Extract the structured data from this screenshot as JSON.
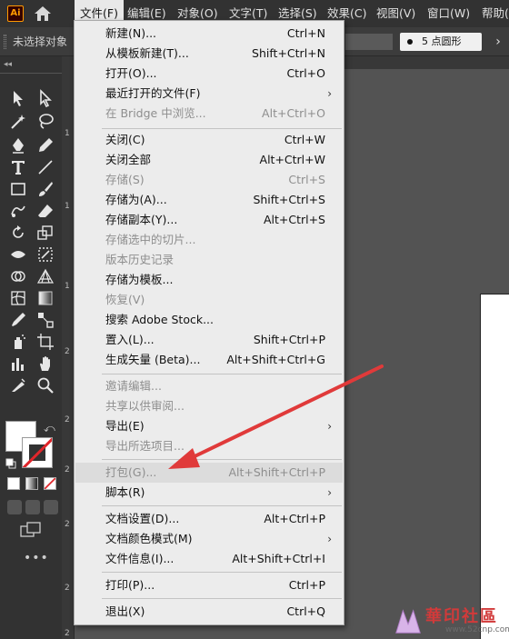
{
  "app": {
    "logo_text": "Ai"
  },
  "menubar": {
    "items": [
      {
        "label": "文件(F)",
        "active": true
      },
      {
        "label": "编辑(E)"
      },
      {
        "label": "对象(O)"
      },
      {
        "label": "文字(T)"
      },
      {
        "label": "选择(S)"
      },
      {
        "label": "效果(C)"
      },
      {
        "label": "视图(V)"
      },
      {
        "label": "窗口(W)"
      },
      {
        "label": "帮助("
      }
    ]
  },
  "controlbar": {
    "selection_status": "未选择对象",
    "brush": {
      "size": "5",
      "label": "点圆形"
    }
  },
  "ruler": {
    "numbers": [
      "1",
      "1",
      "1",
      "2",
      "2",
      "2",
      "2",
      "2",
      "2"
    ]
  },
  "file_menu": {
    "items": [
      {
        "label": "新建(N)...",
        "shortcut": "Ctrl+N",
        "enabled": true
      },
      {
        "label": "从模板新建(T)...",
        "shortcut": "Shift+Ctrl+N",
        "enabled": true
      },
      {
        "label": "打开(O)...",
        "shortcut": "Ctrl+O",
        "enabled": true
      },
      {
        "label": "最近打开的文件(F)",
        "shortcut": "",
        "submenu": true,
        "enabled": true
      },
      {
        "label": "在 Bridge 中浏览...",
        "shortcut": "Alt+Ctrl+O",
        "enabled": false
      },
      {
        "label": "关闭(C)",
        "shortcut": "Ctrl+W",
        "enabled": true
      },
      {
        "label": "关闭全部",
        "shortcut": "Alt+Ctrl+W",
        "enabled": true
      },
      {
        "label": "存储(S)",
        "shortcut": "Ctrl+S",
        "enabled": false
      },
      {
        "label": "存储为(A)...",
        "shortcut": "Shift+Ctrl+S",
        "enabled": true
      },
      {
        "label": "存储副本(Y)...",
        "shortcut": "Alt+Ctrl+S",
        "enabled": true
      },
      {
        "label": "存储选中的切片...",
        "shortcut": "",
        "enabled": false
      },
      {
        "label": "版本历史记录",
        "shortcut": "",
        "enabled": false
      },
      {
        "label": "存储为模板...",
        "shortcut": "",
        "enabled": true
      },
      {
        "label": "恢复(V)",
        "shortcut": "",
        "enabled": false
      },
      {
        "label": "搜索 Adobe Stock...",
        "shortcut": "",
        "enabled": true
      },
      {
        "label": "置入(L)...",
        "shortcut": "Shift+Ctrl+P",
        "enabled": true
      },
      {
        "label": "生成矢量 (Beta)...",
        "shortcut": "Alt+Shift+Ctrl+G",
        "enabled": true
      },
      {
        "label": "邀请编辑...",
        "shortcut": "",
        "enabled": false
      },
      {
        "label": "共享以供审阅...",
        "shortcut": "",
        "enabled": false
      },
      {
        "label": "导出(E)",
        "shortcut": "",
        "submenu": true,
        "enabled": true
      },
      {
        "label": "导出所选项目...",
        "shortcut": "",
        "enabled": false
      },
      {
        "label": "打包(G)...",
        "shortcut": "Alt+Shift+Ctrl+P",
        "enabled": false,
        "highlighted": true
      },
      {
        "label": "脚本(R)",
        "shortcut": "",
        "submenu": true,
        "enabled": true
      },
      {
        "label": "文档设置(D)...",
        "shortcut": "Alt+Ctrl+P",
        "enabled": true
      },
      {
        "label": "文档颜色模式(M)",
        "shortcut": "",
        "submenu": true,
        "enabled": true
      },
      {
        "label": "文件信息(I)...",
        "shortcut": "Alt+Shift+Ctrl+I",
        "enabled": true
      },
      {
        "label": "打印(P)...",
        "shortcut": "Ctrl+P",
        "enabled": true
      },
      {
        "label": "退出(X)",
        "shortcut": "Ctrl+Q",
        "enabled": true
      }
    ]
  },
  "annotation": {
    "color": "#e03a3a"
  },
  "watermark": {
    "text": "華印社區",
    "url": "www.52cnp.com"
  },
  "colors": {
    "menubar_bg": "#323232",
    "menu_bg": "#ececec",
    "disabled_text": "#8e8e8e",
    "canvas_bg": "#535353"
  }
}
